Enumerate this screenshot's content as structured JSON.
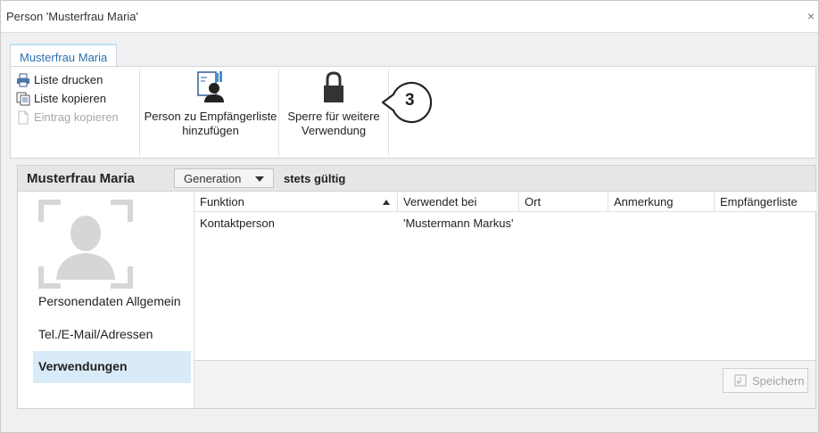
{
  "window": {
    "title": "Person 'Musterfrau Maria'",
    "close_glyph": "×"
  },
  "ribbon": {
    "tab_label": "Musterfrau Maria",
    "small_buttons": {
      "print_label": "Liste drucken",
      "copy_list_label": "Liste kopieren",
      "copy_entry_label": "Eintrag kopieren"
    },
    "add_recipient_label_1": "Person zu Empfängerliste",
    "add_recipient_label_2": "hinzufügen",
    "lock_label_1": "Sperre für weitere",
    "lock_label_2": "Verwendung",
    "callout_number": "3"
  },
  "panel": {
    "person_name": "Musterfrau Maria",
    "generation_label": "Generation",
    "validity": "stets gültig"
  },
  "sidebar": {
    "items": [
      {
        "label": "Personendaten Allgemein",
        "active": false
      },
      {
        "label": "Tel./E-Mail/Adressen",
        "active": false
      },
      {
        "label": "Verwendungen",
        "active": true
      }
    ]
  },
  "grid": {
    "columns": [
      "Funktion",
      "Verwendet bei",
      "Ort",
      "Anmerkung",
      "Empfängerliste"
    ],
    "rows": [
      [
        "Kontaktperson",
        "'Mustermann Markus'",
        "",
        "",
        ""
      ]
    ]
  },
  "footer": {
    "save_label": "Speichern"
  },
  "colors": {
    "accent": "#2a6fb0",
    "active_nav": "#d9ebf8"
  },
  "icons": [
    "close-icon",
    "printer-icon",
    "copy-list-icon",
    "copy-entry-icon",
    "add-recipient-icon",
    "lock-icon",
    "avatar-icon",
    "chevron-down-icon",
    "sort-asc-icon",
    "save-icon"
  ]
}
